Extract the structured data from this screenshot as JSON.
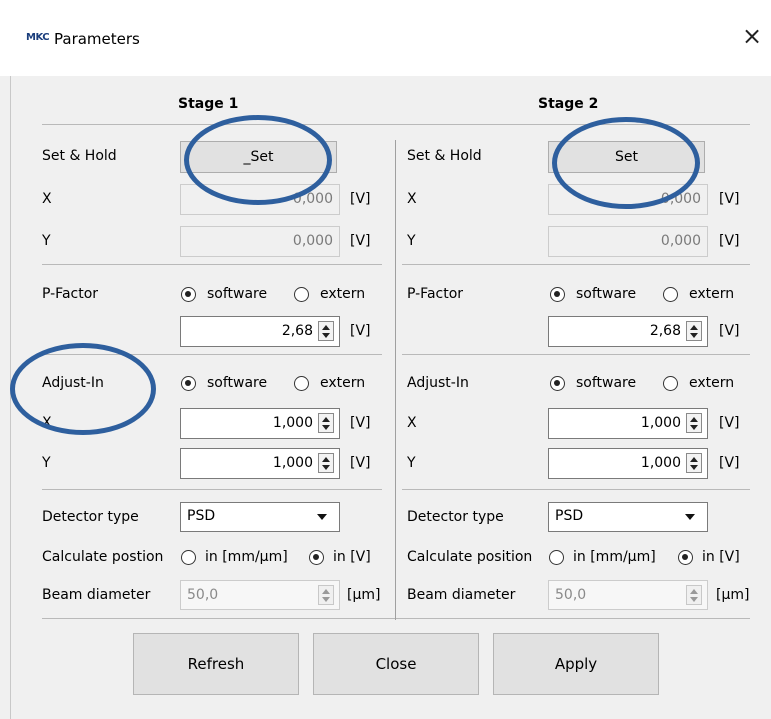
{
  "window": {
    "logo_text": "MKC",
    "title": "Parameters",
    "close_glyph": "×"
  },
  "stage1": {
    "title": "Stage 1",
    "set_hold_label": "Set & Hold",
    "set_button": "_Set",
    "x_label": "X",
    "x_value": "0,000",
    "x_unit": "[V]",
    "y_label": "Y",
    "y_value": "0,000",
    "y_unit": "[V]",
    "pfactor_label": "P-Factor",
    "pfactor_opt1": "software",
    "pfactor_opt2": "extern",
    "pfactor_value": "2,68",
    "pfactor_unit": "[V]",
    "adjust_label": "Adjust-In",
    "adjust_opt1": "software",
    "adjust_opt2": "extern",
    "adjust_x_label": "X",
    "adjust_x_value": "1,000",
    "adjust_x_unit": "[V]",
    "adjust_y_label": "Y",
    "adjust_y_value": "1,000",
    "adjust_y_unit": "[V]",
    "detector_label": "Detector type",
    "detector_value": "PSD",
    "calc_label": "Calculate postion",
    "calc_opt1": "in [mm/µm]",
    "calc_opt2": "in [V]",
    "beam_label": "Beam diameter",
    "beam_value": "50,0",
    "beam_unit": "[µm]"
  },
  "stage2": {
    "title": "Stage 2",
    "set_hold_label": "Set & Hold",
    "set_button": "Set",
    "x_label": "X",
    "x_value": "0,000",
    "x_unit": "[V]",
    "y_label": "Y",
    "y_value": "0,000",
    "y_unit": "[V]",
    "pfactor_label": "P-Factor",
    "pfactor_opt1": "software",
    "pfactor_opt2": "extern",
    "pfactor_value": "2,68",
    "pfactor_unit": "[V]",
    "adjust_label": "Adjust-In",
    "adjust_opt1": "software",
    "adjust_opt2": "extern",
    "adjust_x_label": "X",
    "adjust_x_value": "1,000",
    "adjust_x_unit": "[V]",
    "adjust_y_label": "Y",
    "adjust_y_value": "1,000",
    "adjust_y_unit": "[V]",
    "detector_label": "Detector type",
    "detector_value": "PSD",
    "calc_label": "Calculate position",
    "calc_opt1": "in [mm/µm]",
    "calc_opt2": "in [V]",
    "beam_label": "Beam diameter",
    "beam_value": "50,0",
    "beam_unit": "[µm]"
  },
  "buttons": {
    "refresh": "Refresh",
    "close": "Close",
    "apply": "Apply"
  },
  "colors": {
    "annotation": "#2e5f9e"
  }
}
